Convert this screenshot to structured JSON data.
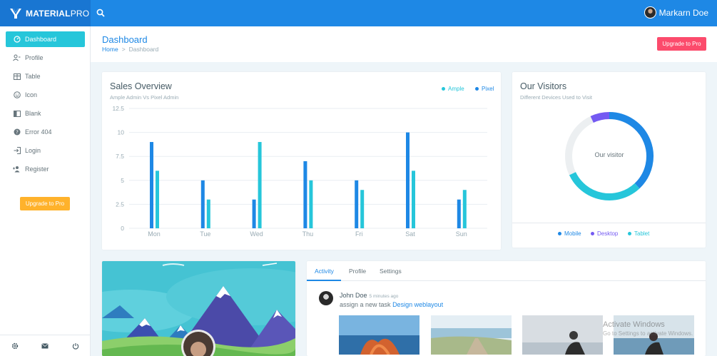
{
  "brand": {
    "bold": "MATERIAL",
    "light": "PRO"
  },
  "topbar": {
    "user_name": "Markarn Doe"
  },
  "sidebar": {
    "items": [
      {
        "label": "Dashboard",
        "icon": "dashboard-icon"
      },
      {
        "label": "Profile",
        "icon": "user-icon"
      },
      {
        "label": "Table",
        "icon": "table-icon"
      },
      {
        "label": "Icon",
        "icon": "smile-icon"
      },
      {
        "label": "Blank",
        "icon": "book-icon"
      },
      {
        "label": "Error 404",
        "icon": "help-icon"
      },
      {
        "label": "Login",
        "icon": "login-icon"
      },
      {
        "label": "Register",
        "icon": "register-icon"
      }
    ],
    "upgrade_label": "Upgrade to Pro"
  },
  "header": {
    "title": "Dashboard",
    "crumb_home": "Home",
    "crumb_sep": ">",
    "crumb_current": "Dashboard",
    "upgrade_label": "Upgrade to Pro"
  },
  "sales": {
    "title": "Sales Overview",
    "subtitle": "Ample Admin Vs Pixel Admin",
    "legend": [
      {
        "name": "Ample",
        "color": "#26c6da"
      },
      {
        "name": "Pixel",
        "color": "#1e88e5"
      }
    ]
  },
  "chart_data": {
    "type": "bar",
    "categories": [
      "Mon",
      "Tue",
      "Wed",
      "Thu",
      "Fri",
      "Sat",
      "Sun"
    ],
    "series": [
      {
        "name": "Pixel",
        "color": "#1e88e5",
        "values": [
          9,
          5,
          3,
          7,
          5,
          10,
          3
        ]
      },
      {
        "name": "Ample",
        "color": "#26c6da",
        "values": [
          6,
          3,
          9,
          5,
          4,
          6,
          4
        ]
      }
    ],
    "yticks": [
      "0",
      "2.5",
      "5",
      "7.5",
      "10",
      "12.5"
    ],
    "ylim": [
      0,
      12.5
    ],
    "grid": true
  },
  "visitors": {
    "title": "Our Visitors",
    "subtitle": "Different Devices Used to Visit",
    "center_label": "Our visitor",
    "segments": [
      {
        "name": "Mobile",
        "color": "#1e88e5",
        "value": 38
      },
      {
        "name": "Tablet",
        "color": "#26c6da",
        "value": 30
      },
      {
        "name": "Background",
        "color": "#eceff1",
        "value": 25
      },
      {
        "name": "Desktop",
        "color": "#745af2",
        "value": 7
      }
    ],
    "legend": [
      {
        "name": "Mobile",
        "color": "#1e88e5"
      },
      {
        "name": "Desktop",
        "color": "#745af2"
      },
      {
        "name": "Tablet",
        "color": "#26c6da"
      }
    ]
  },
  "activity": {
    "tabs": [
      "Activity",
      "Profile",
      "Settings"
    ],
    "user": "John Doe",
    "time": "5 minutes ago",
    "task_prefix": "assign a new task",
    "task_link": "Design weblayout"
  },
  "os_watermark": {
    "line1": "Activate Windows",
    "line2": "Go to Settings to activate Windows."
  }
}
